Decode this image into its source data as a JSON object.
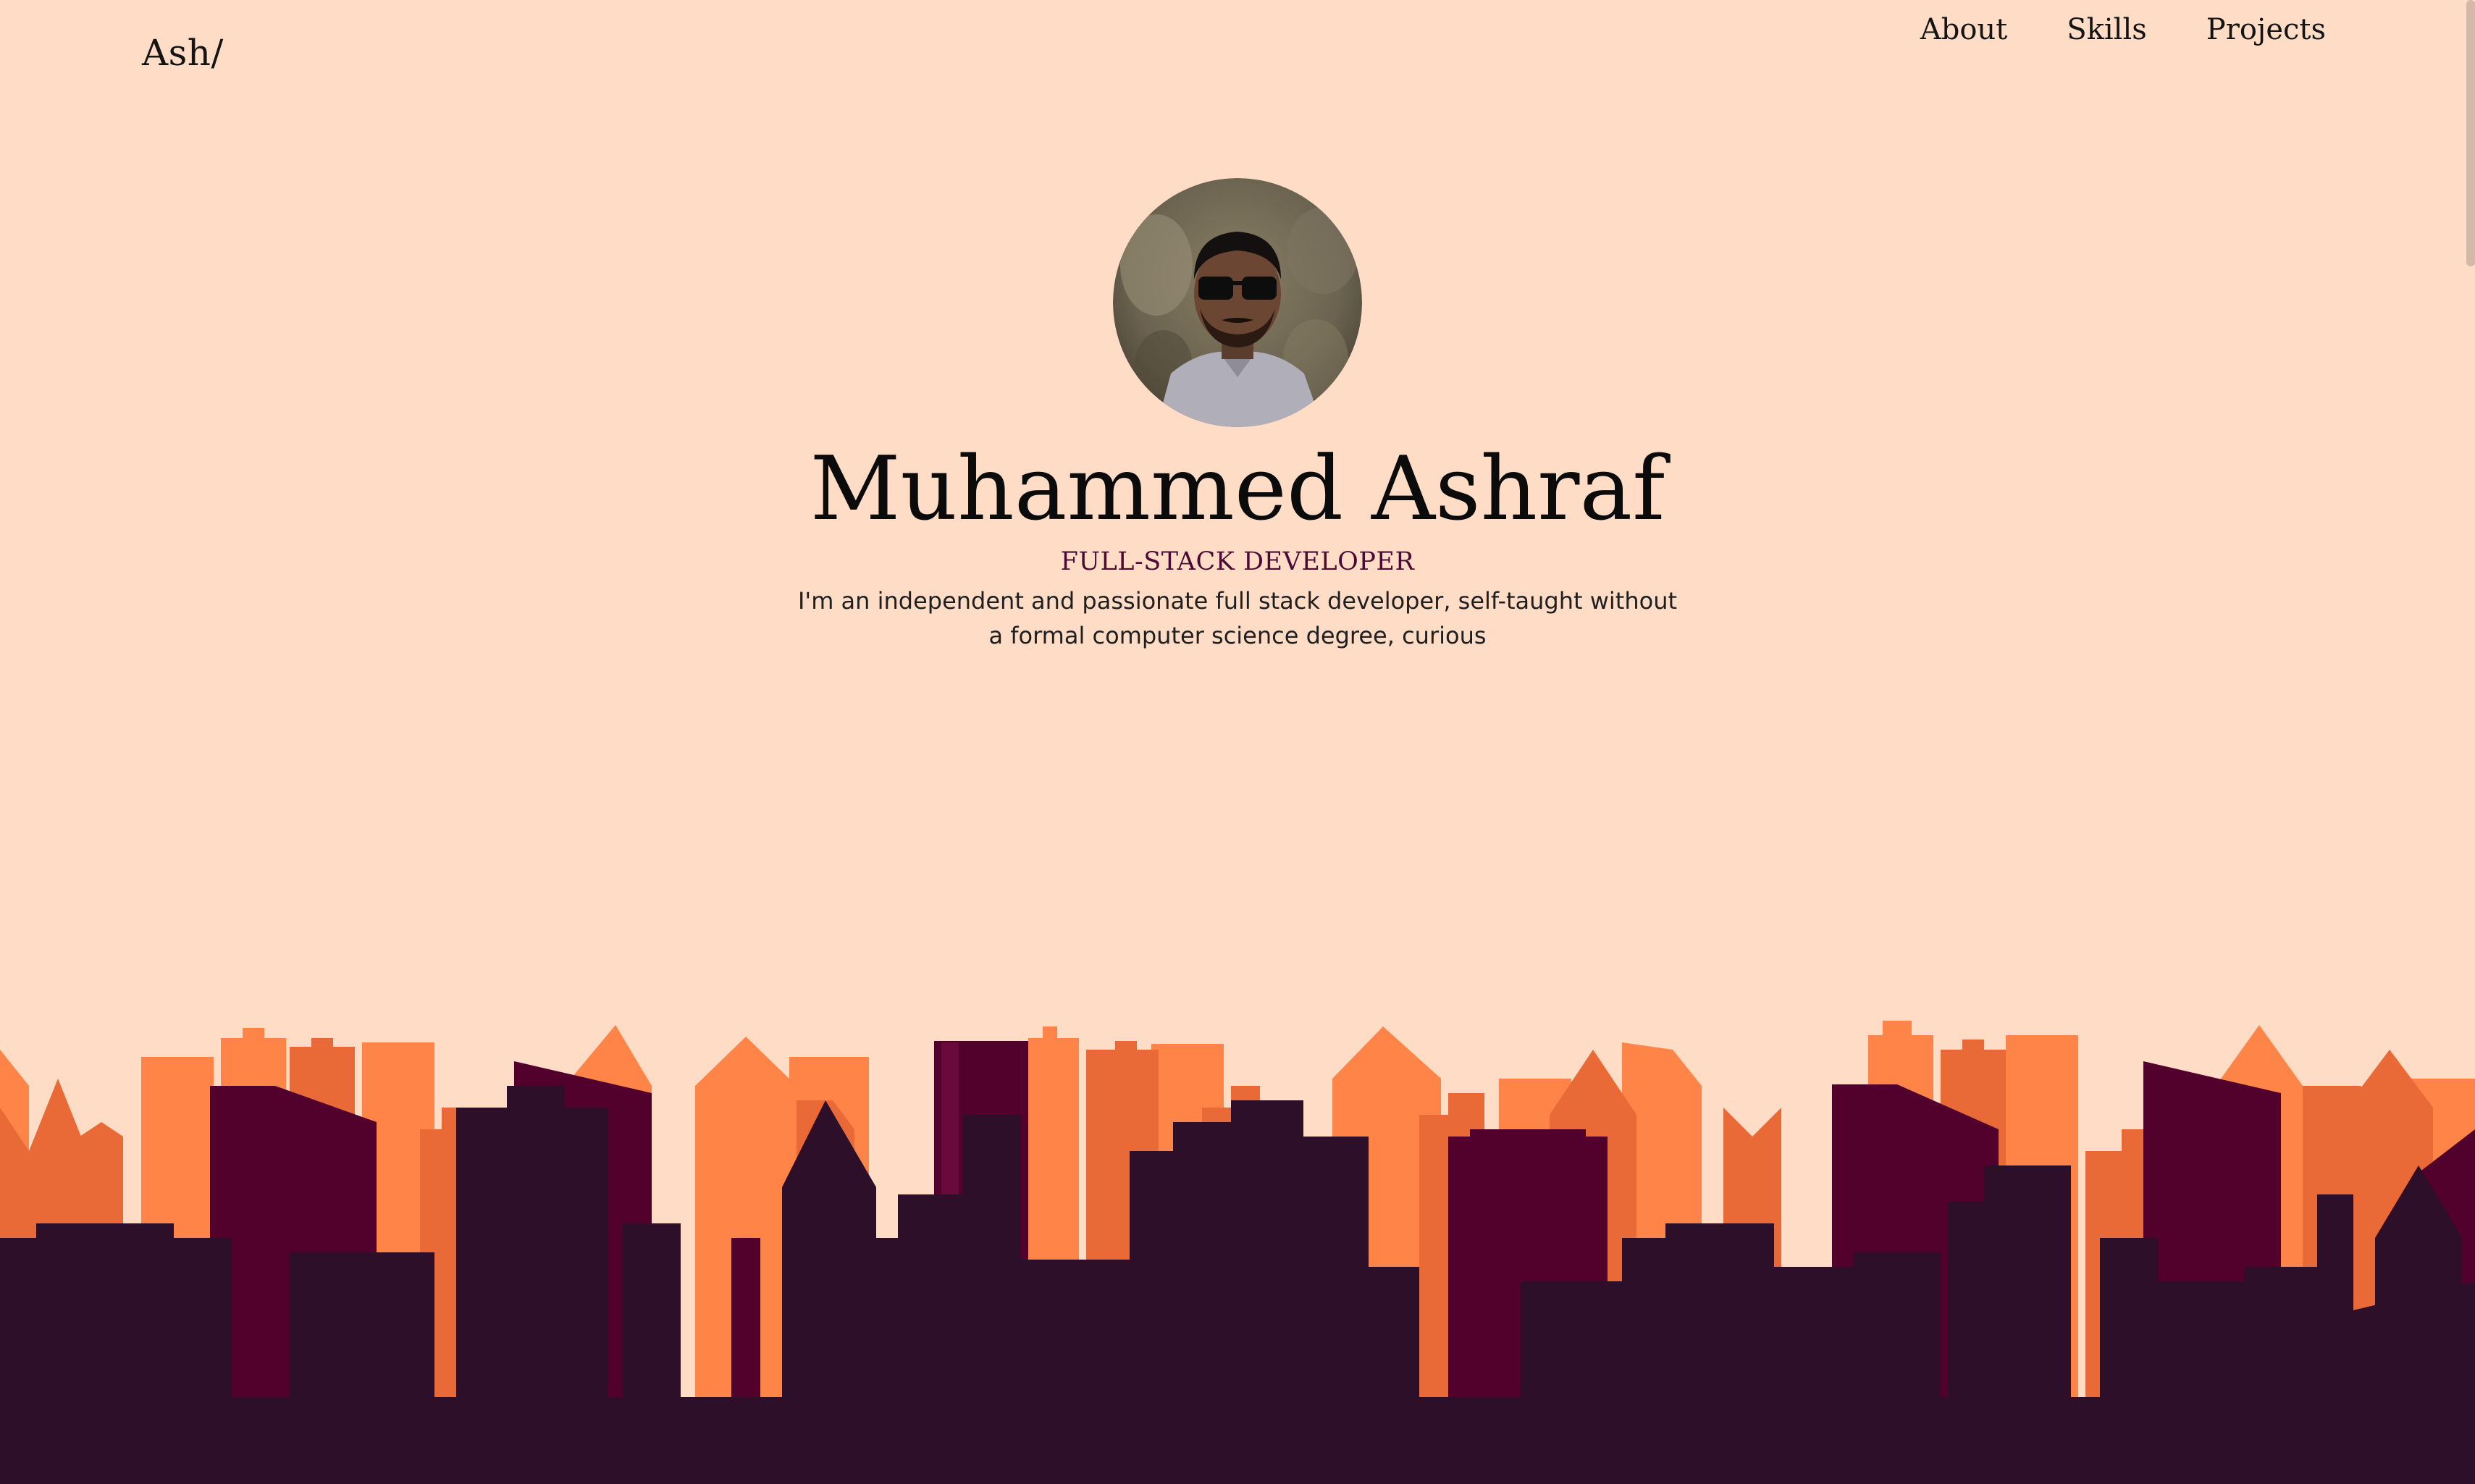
{
  "header": {
    "logo": "Ash/",
    "nav": [
      {
        "label": "About"
      },
      {
        "label": "Skills"
      },
      {
        "label": "Projects"
      }
    ]
  },
  "hero": {
    "name": "Muhammed Ashraf",
    "role": "FULL-STACK DEVELOPER",
    "bio": "I'm an independent and passionate full stack developer, self-taught without a formal computer science degree, curious"
  },
  "colors": {
    "background": "#FFDCC6",
    "building_light": "#FF8447",
    "building_mid": "#E96A37",
    "building_maroon": "#52002C",
    "building_dark": "#2E0F29"
  }
}
